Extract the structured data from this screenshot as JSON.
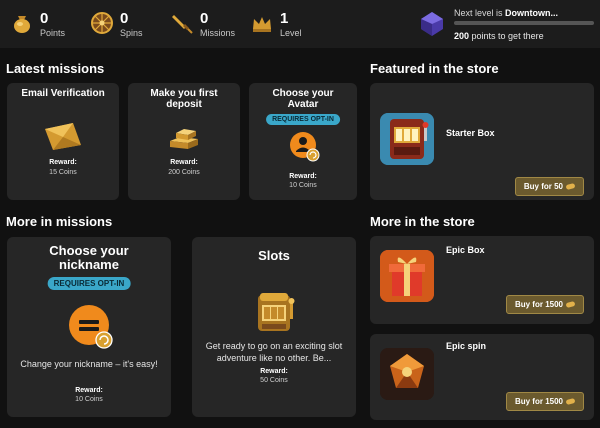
{
  "stats": [
    {
      "value": "0",
      "label": "Points",
      "icon": "bag-icon"
    },
    {
      "value": "0",
      "label": "Spins",
      "icon": "wheel-icon"
    },
    {
      "value": "0",
      "label": "Missions",
      "icon": "dagger-icon"
    },
    {
      "value": "1",
      "label": "Level",
      "icon": "crown-icon"
    }
  ],
  "next_level": {
    "prefix": "Next level is ",
    "name": "Downtown...",
    "points_bold": "200",
    "points_rest": " points to get there",
    "progress": 0.0
  },
  "sections": {
    "latest_missions": "Latest missions",
    "featured_store": "Featured in the store",
    "more_missions": "More in missions",
    "more_store": "More in the store"
  },
  "latest_missions": [
    {
      "title": "Email Verification",
      "reward_label": "Reward:",
      "reward_value": "15 Coins"
    },
    {
      "title": "Make you first deposit",
      "reward_label": "Reward:",
      "reward_value": "200 Coins"
    },
    {
      "title": "Choose your Avatar",
      "optin": "REQUIRES OPT-IN",
      "reward_label": "Reward:",
      "reward_value": "10 Coins"
    }
  ],
  "more_missions": [
    {
      "title": "Choose your nickname",
      "optin": "REQUIRES OPT-IN",
      "description": "Change your nickname – it's easy!",
      "reward_label": "Reward:",
      "reward_value": "10 Coins"
    },
    {
      "title": "Slots",
      "description": "Get ready to go on an exciting slot adventure like no other. Be...",
      "reward_label": "Reward:",
      "reward_value": "50 Coins"
    }
  ],
  "featured_store": {
    "name": "Starter Box",
    "buy_label": "Buy for 50"
  },
  "more_store": [
    {
      "name": "Epic Box",
      "buy_label": "Buy for 1500"
    },
    {
      "name": "Epic spin",
      "buy_label": "Buy for 1500"
    }
  ],
  "colors": {
    "accent_gold": "#d6a43a",
    "optin_blue": "#3aa7c9",
    "card_bg": "#262626",
    "page_bg": "#111111"
  }
}
